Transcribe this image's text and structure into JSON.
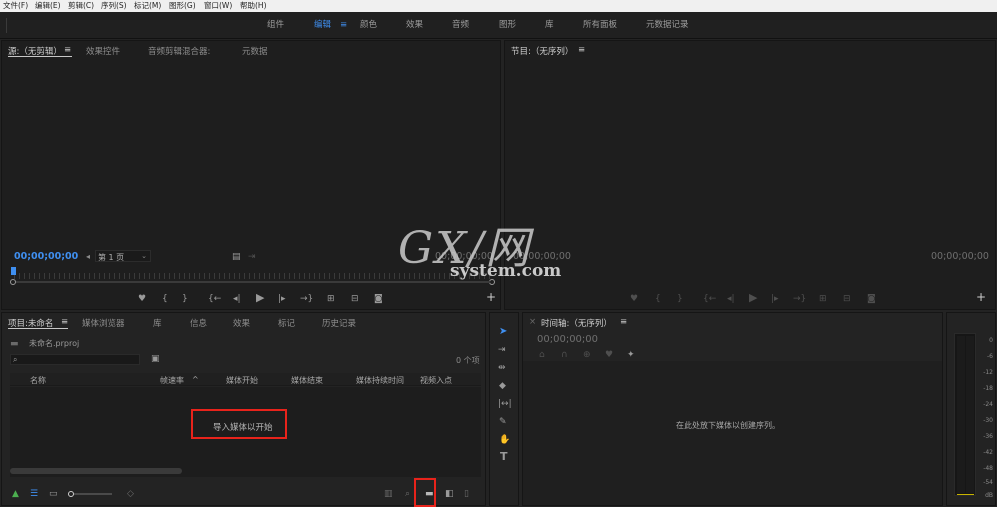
{
  "menu": [
    "文件(F)",
    "编辑(E)",
    "剪辑(C)",
    "序列(S)",
    "标记(M)",
    "图形(G)",
    "窗口(W)",
    "帮助(H)"
  ],
  "workspaces": [
    {
      "label": "组件"
    },
    {
      "label": "编辑",
      "active": true
    },
    {
      "label": "颜色"
    },
    {
      "label": "效果"
    },
    {
      "label": "音频"
    },
    {
      "label": "图形"
    },
    {
      "label": "库"
    },
    {
      "label": "所有面板"
    },
    {
      "label": "元数据记录"
    }
  ],
  "workspace_menu_icon": "≡",
  "source_panel": {
    "tabs": [
      "源:（无剪辑）",
      "效果控件",
      "音频剪辑混合器:",
      "元数据"
    ],
    "menu_icon": "≡",
    "timecode_in": "00;00;00;00",
    "page_select": "第 1 页",
    "timecode_out": "00;00;00;00"
  },
  "program_panel": {
    "title": "节目:（无序列）",
    "menu_icon": "≡",
    "timecode_in": "00;00;00;00",
    "timecode_out": "00;00;00;00"
  },
  "project_panel": {
    "tabs": [
      "项目:未命名",
      "媒体浏览器",
      "库",
      "信息",
      "效果",
      "标记",
      "历史记录"
    ],
    "menu_icon": "≡",
    "file_name": "未命名.prproj",
    "item_count": "0 个项",
    "columns": [
      "名称",
      "帧速率",
      "媒体开始",
      "媒体结束",
      "媒体持续时间",
      "视频入点"
    ],
    "sort_indicator": "^",
    "empty_message": "导入媒体以开始"
  },
  "timeline_panel": {
    "title": "时间轴:（无序列）",
    "menu_icon": "≡",
    "timecode": "00;00;00;00",
    "empty_message": "在此处放下媒体以创建序列。"
  },
  "audio_meter": {
    "labels": [
      "0",
      "-6",
      "-12",
      "-18",
      "-24",
      "-30",
      "-36",
      "-42",
      "-48",
      "-54",
      "dB"
    ]
  },
  "watermark": {
    "logo": "GX/网",
    "site": "system.com"
  },
  "colors": {
    "accent": "#3f8ff0",
    "highlight_box": "#e8231b",
    "panel_bg": "#232323"
  }
}
